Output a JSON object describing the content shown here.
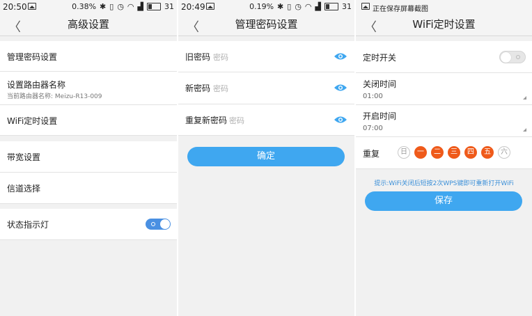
{
  "screen1": {
    "status": {
      "time": "20:50",
      "info": "0.38%",
      "battery": "31"
    },
    "nav": {
      "title": "高级设置"
    },
    "items": {
      "admin_password": "管理密码设置",
      "router_name": "设置路由器名称",
      "router_name_sub": "当前路由器名称:  Meizu-R13-009",
      "wifi_timer": "WiFi定时设置",
      "bandwidth": "带宽设置",
      "channel": "信道选择",
      "status_light": "状态指示灯"
    },
    "status_light_on": true
  },
  "screen2": {
    "status": {
      "time": "20:49",
      "info": "0.19%",
      "battery": "31"
    },
    "nav": {
      "title": "管理密码设置"
    },
    "fields": [
      {
        "label": "旧密码",
        "placeholder": "密码"
      },
      {
        "label": "新密码",
        "placeholder": "密码"
      },
      {
        "label": "重复新密码",
        "placeholder": "密码"
      }
    ],
    "confirm": "确定"
  },
  "screen3": {
    "status": {
      "text": "正在保存屏幕截图"
    },
    "nav": {
      "title": "WiFi定时设置"
    },
    "timer_switch": "定时开关",
    "timer_switch_on": false,
    "off_time": {
      "label": "关闭时间",
      "value": "01:00"
    },
    "on_time": {
      "label": "开启时间",
      "value": "07:00"
    },
    "repeat": {
      "label": "重复",
      "days": [
        {
          "name": "日",
          "on": false
        },
        {
          "name": "一",
          "on": true
        },
        {
          "name": "二",
          "on": true
        },
        {
          "name": "三",
          "on": true
        },
        {
          "name": "四",
          "on": true
        },
        {
          "name": "五",
          "on": true
        },
        {
          "name": "六",
          "on": false
        }
      ]
    },
    "hint": "提示:WiFi关闭后短按2次WPS键即可重新打开WiFi",
    "save": "保存"
  },
  "colors": {
    "accent": "#3fa7f0",
    "day_on": "#ef5a1a",
    "toggle_on": "#4a90e2"
  },
  "icons": [
    "back-icon",
    "eye-icon",
    "image-icon",
    "bluetooth-icon",
    "wifi-icon",
    "battery-icon"
  ]
}
